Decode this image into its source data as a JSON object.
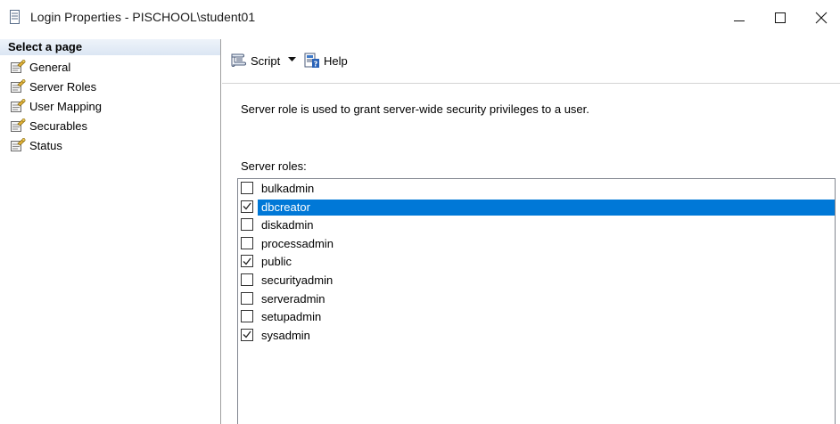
{
  "window": {
    "title": "Login Properties - PISCHOOL\\student01",
    "controls": {
      "minimize_icon": "minimize-icon",
      "maximize_icon": "maximize-icon",
      "close_icon": "close-icon"
    }
  },
  "nav": {
    "header": "Select a page",
    "items": [
      {
        "label": "General",
        "icon": "page-wrench-icon"
      },
      {
        "label": "Server Roles",
        "icon": "page-wrench-icon"
      },
      {
        "label": "User Mapping",
        "icon": "page-wrench-icon"
      },
      {
        "label": "Securables",
        "icon": "page-wrench-icon"
      },
      {
        "label": "Status",
        "icon": "page-wrench-icon"
      }
    ]
  },
  "toolbar": {
    "script_label": "Script",
    "help_label": "Help"
  },
  "content": {
    "description": "Server role is used to grant server-wide security privileges to a user.",
    "roles_label": "Server roles:",
    "roles": [
      {
        "name": "bulkadmin",
        "checked": false,
        "selected": false
      },
      {
        "name": "dbcreator",
        "checked": true,
        "selected": true
      },
      {
        "name": "diskadmin",
        "checked": false,
        "selected": false
      },
      {
        "name": "processadmin",
        "checked": false,
        "selected": false
      },
      {
        "name": "public",
        "checked": true,
        "selected": false
      },
      {
        "name": "securityadmin",
        "checked": false,
        "selected": false
      },
      {
        "name": "serveradmin",
        "checked": false,
        "selected": false
      },
      {
        "name": "setupadmin",
        "checked": false,
        "selected": false
      },
      {
        "name": "sysadmin",
        "checked": true,
        "selected": false
      }
    ]
  },
  "colors": {
    "selection": "#0078d7",
    "nav_header_top": "#eef3fa",
    "nav_header_bottom": "#dbe6f3"
  }
}
